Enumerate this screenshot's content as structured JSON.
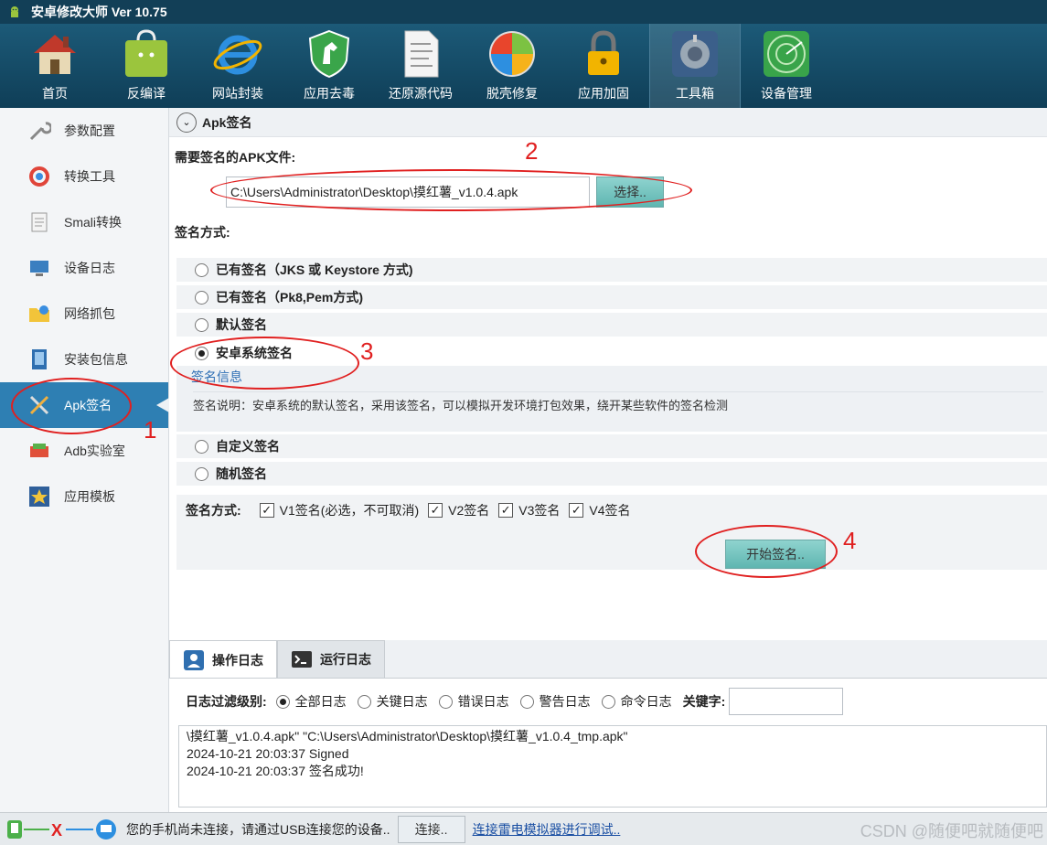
{
  "window": {
    "title": "安卓修改大师 Ver 10.75"
  },
  "toolbar": {
    "items": [
      {
        "label": "首页",
        "icon": "home-icon"
      },
      {
        "label": "反编译",
        "icon": "android-bag-icon"
      },
      {
        "label": "网站封装",
        "icon": "ie-browser-icon"
      },
      {
        "label": "应用去毒",
        "icon": "shield-horse-icon"
      },
      {
        "label": "还原源代码",
        "icon": "document-icon"
      },
      {
        "label": "脱壳修复",
        "icon": "windows-ball-icon"
      },
      {
        "label": "应用加固",
        "icon": "padlock-icon"
      },
      {
        "label": "工具箱",
        "icon": "toolbox-icon"
      },
      {
        "label": "设备管理",
        "icon": "radar-icon"
      }
    ],
    "active": "工具箱"
  },
  "sidebar": {
    "items": [
      {
        "label": "参数配置",
        "icon": "wrench-icon"
      },
      {
        "label": "转换工具",
        "icon": "convert-ring-icon"
      },
      {
        "label": "Smali转换",
        "icon": "smali-doc-icon"
      },
      {
        "label": "设备日志",
        "icon": "device-log-icon"
      },
      {
        "label": "网络抓包",
        "icon": "network-folder-icon"
      },
      {
        "label": "安装包信息",
        "icon": "package-info-icon"
      },
      {
        "label": "Apk签名",
        "icon": "tools-cross-icon"
      },
      {
        "label": "Adb实验室",
        "icon": "adb-lab-icon"
      },
      {
        "label": "应用模板",
        "icon": "star-template-icon"
      }
    ],
    "active": "Apk签名"
  },
  "main": {
    "section_title": "Apk签名",
    "apk_file_label": "需要签名的APK文件:",
    "apk_path": "C:\\Users\\Administrator\\Desktop\\摸红薯_v1.0.4.apk",
    "choose_button": "选择..",
    "sign_method_label": "签名方式:",
    "options": [
      "已有签名（JKS 或 Keystore 方式)",
      "已有签名（Pk8,Pem方式)",
      "默认签名",
      "安卓系统签名",
      "自定义签名",
      "随机签名"
    ],
    "selected_option": "安卓系统签名",
    "sig_info_title": "签名信息",
    "sig_info_desc": "签名说明：安卓系统的默认签名，采用该签名，可以模拟开发环境打包效果，绕开某些软件的签名检测",
    "scheme_label": "签名方式:",
    "schemes": [
      {
        "label": "V1签名(必选，不可取消)",
        "checked": true
      },
      {
        "label": "V2签名",
        "checked": true
      },
      {
        "label": "V3签名",
        "checked": true
      },
      {
        "label": "V4签名",
        "checked": true
      }
    ],
    "start_button": "开始签名.."
  },
  "annotations": [
    "1",
    "2",
    "3",
    "4"
  ],
  "log": {
    "tabs": [
      {
        "label": "操作日志",
        "icon": "user-log-icon"
      },
      {
        "label": "运行日志",
        "icon": "terminal-icon"
      }
    ],
    "filter_label": "日志过滤级别:",
    "filters": [
      "全部日志",
      "关键日志",
      "错误日志",
      "警告日志",
      "命令日志"
    ],
    "selected_filter": "全部日志",
    "keyword_label": "关键字:",
    "keyword_value": "",
    "lines": [
      "\\摸红薯_v1.0.4.apk\" \"C:\\Users\\Administrator\\Desktop\\摸红薯_v1.0.4_tmp.apk\"",
      "2024-10-21 20:03:37 Signed",
      "2024-10-21 20:03:37 签名成功!"
    ]
  },
  "statusbar": {
    "message": "您的手机尚未连接，请通过USB连接您的设备..",
    "connect_button": "连接..",
    "link": "连接雷电模拟器进行调试..",
    "watermark": "CSDN @随便吧就随便吧"
  },
  "colors": {
    "accent": "#2e7fb3",
    "annotation": "#e02020",
    "button": "#6ec2bd",
    "toolbar": "#1c5a78"
  }
}
